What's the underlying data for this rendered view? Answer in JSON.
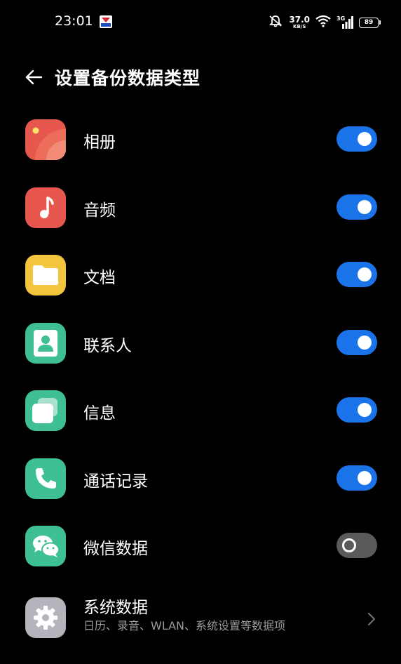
{
  "status_bar": {
    "time": "23:01",
    "net_speed_value": "37.0",
    "net_speed_unit": "KB/S",
    "signal_label": "3G",
    "battery": "89"
  },
  "header": {
    "title": "设置备份数据类型"
  },
  "items": [
    {
      "label": "相册",
      "icon": "photos-icon",
      "toggle": true
    },
    {
      "label": "音频",
      "icon": "music-icon",
      "toggle": true
    },
    {
      "label": "文档",
      "icon": "folder-icon",
      "toggle": true
    },
    {
      "label": "联系人",
      "icon": "contacts-icon",
      "toggle": true
    },
    {
      "label": "信息",
      "icon": "messages-icon",
      "toggle": true
    },
    {
      "label": "通话记录",
      "icon": "phone-icon",
      "toggle": true
    },
    {
      "label": "微信数据",
      "icon": "wechat-icon",
      "toggle": false
    }
  ],
  "system_data": {
    "title": "系统数据",
    "description": "日历、录音、WLAN、系统设置等数据项",
    "icon": "gear-icon"
  },
  "colors": {
    "toggle_on": "#1a73e8",
    "toggle_off": "#5a5a5a",
    "photos": "#e8574d",
    "music": "#e8574d",
    "folder": "#f2c53d",
    "contacts": "#3fbf95",
    "messages": "#3fbf95",
    "phone": "#3fbf95",
    "wechat": "#3fbf95",
    "system": "#b4b4bc"
  }
}
